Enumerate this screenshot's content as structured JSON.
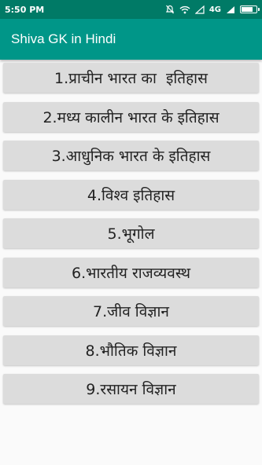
{
  "status_bar": {
    "time": "5:50 PM",
    "network": "4G",
    "battery_level": 0.85,
    "icons": [
      "mute-icon",
      "wifi-icon",
      "signal-icon",
      "signal-icon",
      "battery-icon"
    ]
  },
  "app_bar": {
    "title": "Shiva GK in Hindi",
    "color": "#009688",
    "status_color": "#007a66"
  },
  "menu": {
    "items": [
      {
        "label": "1.प्राचीन भारत का  इतिहास"
      },
      {
        "label": "2.मध्य कालीन भारत के इतिहास"
      },
      {
        "label": "3.आधुनिक भारत के इतिहास"
      },
      {
        "label": "4.विश्व इतिहास"
      },
      {
        "label": "5.भूगोल"
      },
      {
        "label": "6.भारतीय राजव्यवस्थ"
      },
      {
        "label": "7.जीव विज्ञान"
      },
      {
        "label": "8.भौतिक विज्ञान"
      },
      {
        "label": "9.रसायन विज्ञान"
      }
    ]
  }
}
